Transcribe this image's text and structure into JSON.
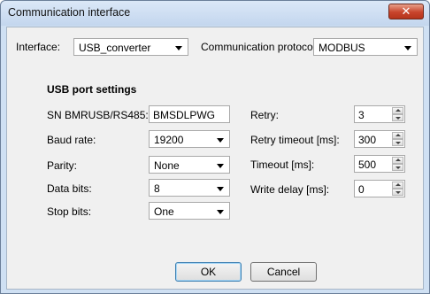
{
  "window": {
    "title": "Communication interface",
    "close_label": "✕"
  },
  "interface": {
    "label": "Interface:",
    "value": "USB_converter"
  },
  "protocol": {
    "label": "Communication protocol:",
    "value": "MODBUS"
  },
  "usb": {
    "heading": "USB port settings",
    "sn_label": "SN BMRUSB/RS485:",
    "sn_value": "BMSDLPWG",
    "baud_label": "Baud rate:",
    "baud_value": "19200",
    "parity_label": "Parity:",
    "parity_value": "None",
    "databits_label": "Data bits:",
    "databits_value": "8",
    "stopbits_label": "Stop bits:",
    "stopbits_value": "One"
  },
  "timing": {
    "retry_label": "Retry:",
    "retry_value": "3",
    "retry_timeout_label": "Retry timeout [ms]:",
    "retry_timeout_value": "300",
    "timeout_label": "Timeout [ms]:",
    "timeout_value": "500",
    "write_delay_label": "Write delay [ms]:",
    "write_delay_value": "0"
  },
  "buttons": {
    "ok": "OK",
    "cancel": "Cancel"
  },
  "icons": [
    "close-icon",
    "dropdown-arrow-icon",
    "spin-up-icon",
    "spin-down-icon"
  ]
}
